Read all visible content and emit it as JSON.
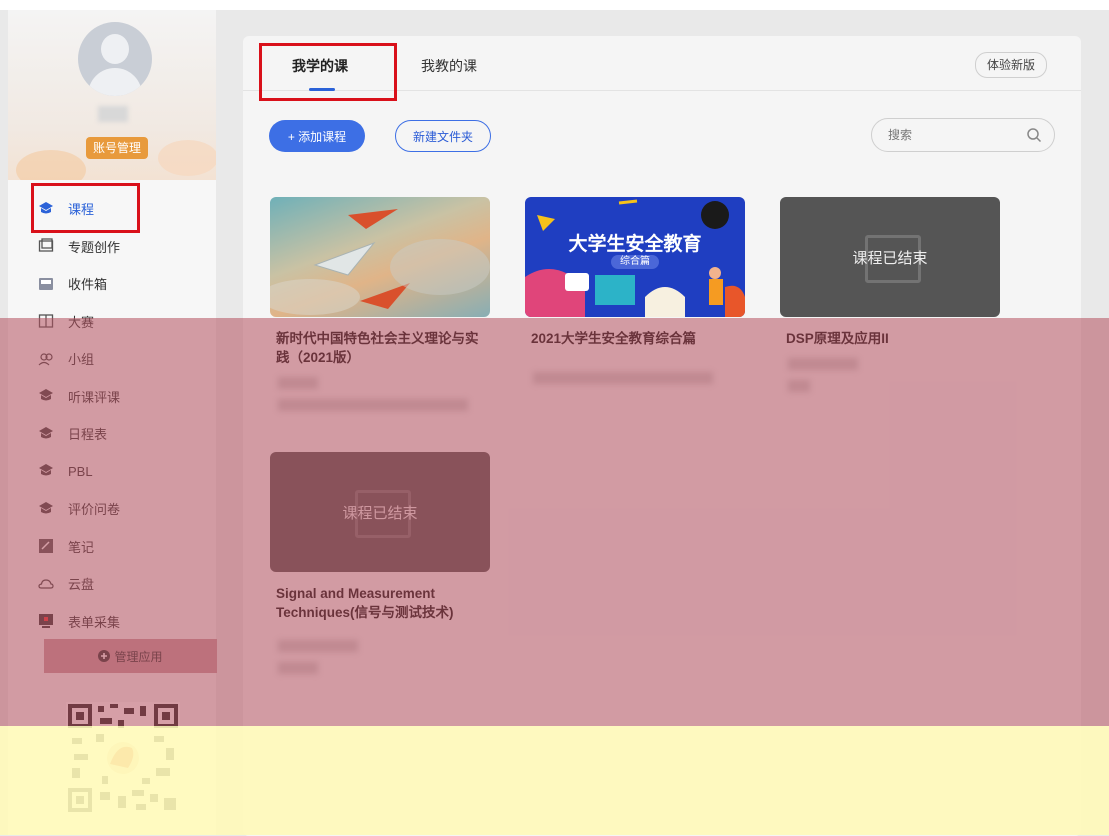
{
  "sidebar": {
    "account_button": "账号管理",
    "items": [
      {
        "label": "课程",
        "icon": "course-icon",
        "active": true
      },
      {
        "label": "专题创作",
        "icon": "topic-icon"
      },
      {
        "label": "收件箱",
        "icon": "inbox-icon"
      },
      {
        "label": "大赛",
        "icon": "contest-icon"
      },
      {
        "label": "小组",
        "icon": "group-icon"
      },
      {
        "label": "听课评课",
        "icon": "review-icon"
      },
      {
        "label": "日程表",
        "icon": "schedule-icon"
      },
      {
        "label": "PBL",
        "icon": "pbl-icon"
      },
      {
        "label": "评价问卷",
        "icon": "survey-icon"
      },
      {
        "label": "笔记",
        "icon": "note-icon"
      },
      {
        "label": "云盘",
        "icon": "cloud-icon"
      },
      {
        "label": "表单采集",
        "icon": "form-icon"
      }
    ],
    "manage_apps": "管理应用"
  },
  "tabs": {
    "my_courses": "我学的课",
    "teach_courses": "我教的课",
    "try_new": "体验新版"
  },
  "toolbar": {
    "add_course": "+ 添加课程",
    "new_folder": "新建文件夹",
    "search_placeholder": "搜索"
  },
  "courses": [
    {
      "title": "新时代中国特色社会主义理论与实践（2021版）"
    },
    {
      "title": "2021大学生安全教育综合篇",
      "thumb_title": "大学生安全教育",
      "thumb_sub": "综合篇"
    },
    {
      "title": "DSP原理及应用II",
      "status": "课程已结束"
    },
    {
      "title": "Signal and Measurement Techniques(信号与测试技术)",
      "status": "课程已结束"
    }
  ],
  "colors": {
    "accent": "#2b62d8",
    "account_button": "#e89a3c",
    "highlight": "#d9101a"
  }
}
